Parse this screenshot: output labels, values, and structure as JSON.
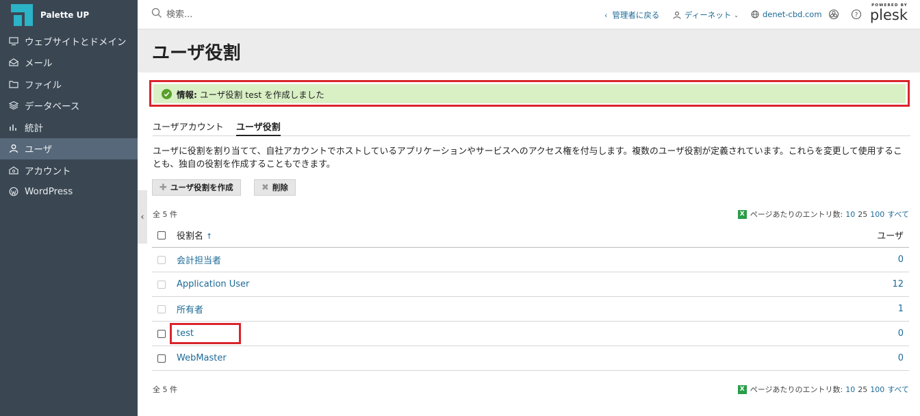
{
  "brand": {
    "name": "Palette UP",
    "accent": "#2bb3c8"
  },
  "sidebar": {
    "items": [
      {
        "label": "ウェブサイトとドメイン",
        "icon": "monitor-icon",
        "active": false
      },
      {
        "label": "メール",
        "icon": "mail-icon",
        "active": false
      },
      {
        "label": "ファイル",
        "icon": "folder-icon",
        "active": false
      },
      {
        "label": "データベース",
        "icon": "database-icon",
        "active": false
      },
      {
        "label": "統計",
        "icon": "chart-icon",
        "active": false
      },
      {
        "label": "ユーザ",
        "icon": "user-icon",
        "active": true
      },
      {
        "label": "アカウント",
        "icon": "account-icon",
        "active": false
      },
      {
        "label": "WordPress",
        "icon": "wordpress-icon",
        "active": false
      }
    ]
  },
  "header": {
    "search_placeholder": "検索...",
    "back_admin": "管理者に戻る",
    "user": "ディーネット",
    "domain": "denet-cbd.com",
    "powered_by": "POWERED BY",
    "plesk": "plesk"
  },
  "page": {
    "title": "ユーザ役割"
  },
  "alert": {
    "label": "情報:",
    "message": "ユーザ役割 test を作成しました",
    "color": "#d9f0c5"
  },
  "tabs": [
    {
      "label": "ユーザアカウント",
      "active": false
    },
    {
      "label": "ユーザ役割",
      "active": true
    }
  ],
  "description": "ユーザに役割を割り当てて、自社アカウントでホストしているアプリケーションやサービスへのアクセス権を付与します。複数のユーザ役割が定義されています。これらを変更して使用することも、独自の役割を作成することもできます。",
  "toolbar": {
    "create_label": "ユーザ役割を作成",
    "delete_label": "削除"
  },
  "list": {
    "total": "全 5 件",
    "per_page_label": "ページあたりのエントリ数:",
    "per_page_options": [
      "10",
      "25",
      "100",
      "すべて"
    ],
    "columns": {
      "name": "役割名",
      "sort_indicator": "↑",
      "users": "ユーザ"
    },
    "rows": [
      {
        "name": "会計担当者",
        "users": "0",
        "checkbox_enabled": false
      },
      {
        "name": "Application User",
        "users": "12",
        "checkbox_enabled": false
      },
      {
        "name": "所有者",
        "users": "1",
        "checkbox_enabled": false
      },
      {
        "name": "test",
        "users": "0",
        "checkbox_enabled": true
      },
      {
        "name": "WebMaster",
        "users": "0",
        "checkbox_enabled": true
      }
    ]
  }
}
